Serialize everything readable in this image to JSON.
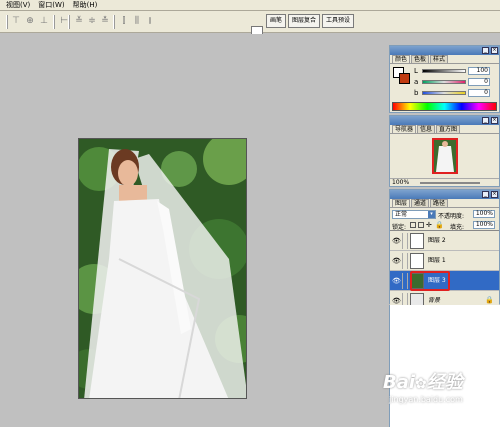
{
  "menubar": {
    "items": [
      "视图(V)",
      "窗口(W)",
      "帮助(H)"
    ]
  },
  "palette_well": {
    "tabs": [
      "画笔",
      "图层复合",
      "工具预设"
    ]
  },
  "color_panel": {
    "tabs": [
      "颜色",
      "色板",
      "样式"
    ],
    "channels": [
      {
        "label": "L",
        "value": "100"
      },
      {
        "label": "a",
        "value": "0"
      },
      {
        "label": "b",
        "value": "0"
      }
    ]
  },
  "navigator_panel": {
    "tabs": [
      "导航器",
      "信息",
      "直方图"
    ],
    "zoom": "100%"
  },
  "layers_panel": {
    "tabs": [
      "图层",
      "通道",
      "路径"
    ],
    "blend_mode": "正常",
    "opacity_label": "不透明度:",
    "opacity_value": "100%",
    "lock_label": "锁定:",
    "fill_label": "填充:",
    "fill_value": "100%",
    "layers": [
      {
        "name": "图层 2",
        "selected": false
      },
      {
        "name": "图层 1",
        "selected": false
      },
      {
        "name": "图层 3",
        "selected": true
      },
      {
        "name": "背景",
        "selected": false
      }
    ]
  },
  "watermark": {
    "brand": "Bai",
    "brand2": "经验",
    "url": "jingyan.baidu.com"
  },
  "colors": {
    "accent": "#316ac5",
    "highlight": "#e02020",
    "workspace": "#c0c0c0"
  }
}
